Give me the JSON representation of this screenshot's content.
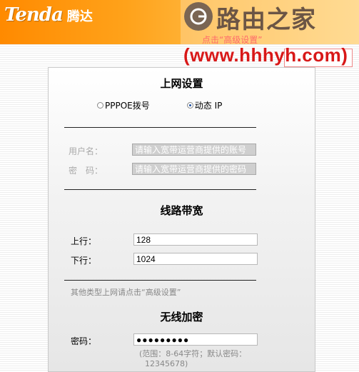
{
  "header": {
    "brand_en": "Tenda",
    "brand_cn": "腾达",
    "watermark_title": "路由之家",
    "watermark_sub": "点击“高级设置”",
    "watermark_url": "(www.hhhyh.com)"
  },
  "internet": {
    "title": "上网设置",
    "options": [
      {
        "label": "PPPOE拨号",
        "checked": false
      },
      {
        "label": "动态 IP",
        "checked": true
      }
    ],
    "username_label": "用户名：",
    "username_placeholder": "请输入宽带运营商提供的账号",
    "password_label": "密　码：",
    "password_placeholder": "请输入宽带运营商提供的密码"
  },
  "bandwidth": {
    "title": "线路带宽",
    "up_label": "上行：",
    "up_value": "128",
    "down_label": "下行：",
    "down_value": "1024",
    "hint": "其他类型上网请点击“高级设置”"
  },
  "wireless": {
    "title": "无线加密",
    "password_label": "密码：",
    "password_value": "●●●●●●●●●",
    "hint_line1": "(范围：8-64字符；默认密码：",
    "hint_line2": "12345678)"
  },
  "colors": {
    "banner": "#ff9a10",
    "watermark_url": "#d81818"
  }
}
